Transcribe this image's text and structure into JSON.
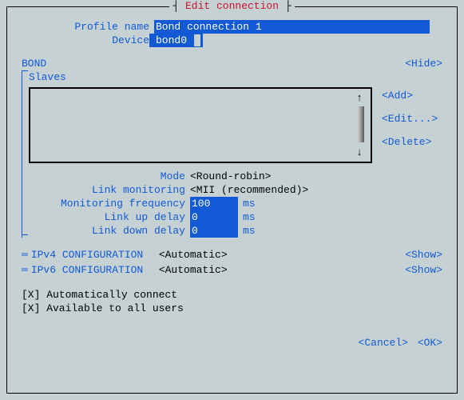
{
  "title": "Edit connection",
  "fields": {
    "profile_name_label": "Profile name",
    "profile_name_value": "Bond connection 1",
    "device_label": "Device",
    "device_value": "bond0"
  },
  "bond": {
    "section": "BOND",
    "slaves_label": "Slaves",
    "hide": "<Hide>",
    "add": "<Add>",
    "edit": "<Edit...>",
    "delete": "<Delete>",
    "mode_label": "Mode",
    "mode_value": "<Round-robin>",
    "link_mon_label": "Link monitoring",
    "link_mon_value": "<MII (recommended)>",
    "mon_freq_label": "Monitoring frequency",
    "mon_freq_value": "100",
    "link_up_label": "Link up delay",
    "link_up_value": "0",
    "link_down_label": "Link down delay",
    "link_down_value": "0",
    "unit": "ms"
  },
  "ipv4": {
    "label": "IPv4 CONFIGURATION",
    "value": "<Automatic>",
    "show": "<Show>"
  },
  "ipv6": {
    "label": "IPv6 CONFIGURATION",
    "value": "<Automatic>",
    "show": "<Show>"
  },
  "checks": {
    "auto_connect": "[X] Automatically connect",
    "all_users": "[X] Available to all users"
  },
  "footer": {
    "cancel": "<Cancel>",
    "ok": "<OK>"
  }
}
